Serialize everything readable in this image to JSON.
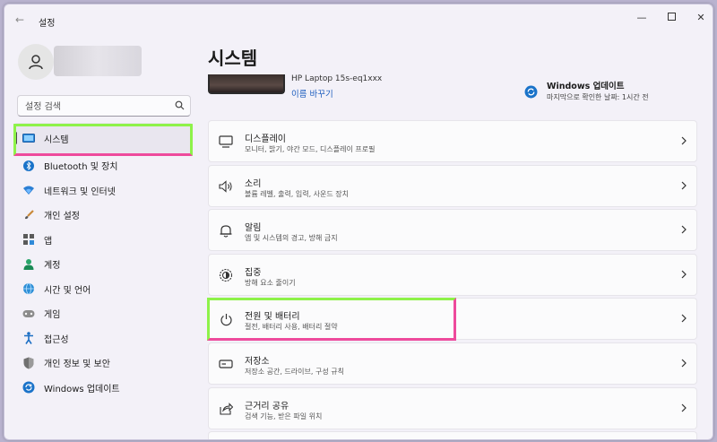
{
  "window": {
    "title": "설정",
    "back_label": "←",
    "controls": {
      "minimize": "—",
      "close": "✕"
    }
  },
  "profile": {
    "avatar_icon": "person-icon"
  },
  "search": {
    "placeholder": "설정 검색"
  },
  "sidebar": {
    "items": [
      {
        "label": "시스템",
        "icon": "monitor-icon",
        "selected": true
      },
      {
        "label": "Bluetooth 및 장치",
        "icon": "bluetooth-icon"
      },
      {
        "label": "네트워크 및 인터넷",
        "icon": "wifi-icon"
      },
      {
        "label": "개인 설정",
        "icon": "brush-icon"
      },
      {
        "label": "앱",
        "icon": "apps-icon"
      },
      {
        "label": "계정",
        "icon": "account-icon"
      },
      {
        "label": "시간 및 언어",
        "icon": "globe-clock-icon"
      },
      {
        "label": "게임",
        "icon": "gamepad-icon"
      },
      {
        "label": "접근성",
        "icon": "accessibility-icon"
      },
      {
        "label": "개인 정보 및 보안",
        "icon": "shield-icon"
      },
      {
        "label": "Windows 업데이트",
        "icon": "update-icon"
      }
    ]
  },
  "main": {
    "title": "시스템",
    "device": {
      "name": "HP Laptop 15s-eq1xxx",
      "rename": "이름 바꾸기"
    },
    "update": {
      "title": "Windows 업데이트",
      "subtitle": "마지막으로 확인한 날짜: 1시간 전"
    },
    "cards": [
      {
        "title": "디스플레이",
        "subtitle": "모니터, 밝기, 야간 모드, 디스플레이 프로필",
        "icon": "display-icon"
      },
      {
        "title": "소리",
        "subtitle": "볼륨 레벨, 출력, 입력, 사운드 장치",
        "icon": "speaker-icon"
      },
      {
        "title": "알림",
        "subtitle": "앱 및 시스템의 경고, 방해 금지",
        "icon": "bell-icon"
      },
      {
        "title": "집중",
        "subtitle": "방해 요소 줄이기",
        "icon": "focus-icon"
      },
      {
        "title": "전원 및 배터리",
        "subtitle": "절전, 배터리 사용, 배터리 절약",
        "icon": "power-icon"
      },
      {
        "title": "저장소",
        "subtitle": "저장소 공간, 드라이브, 구성 규칙",
        "icon": "storage-icon"
      },
      {
        "title": "근거리 공유",
        "subtitle": "검색 기능, 받은 파일 위치",
        "icon": "share-icon"
      }
    ]
  },
  "colors": {
    "highlight_green": "#8ef24a",
    "highlight_pink": "#ee4a9c",
    "link_blue": "#1f5fbf",
    "accent_blue": "#0f6cbd"
  }
}
